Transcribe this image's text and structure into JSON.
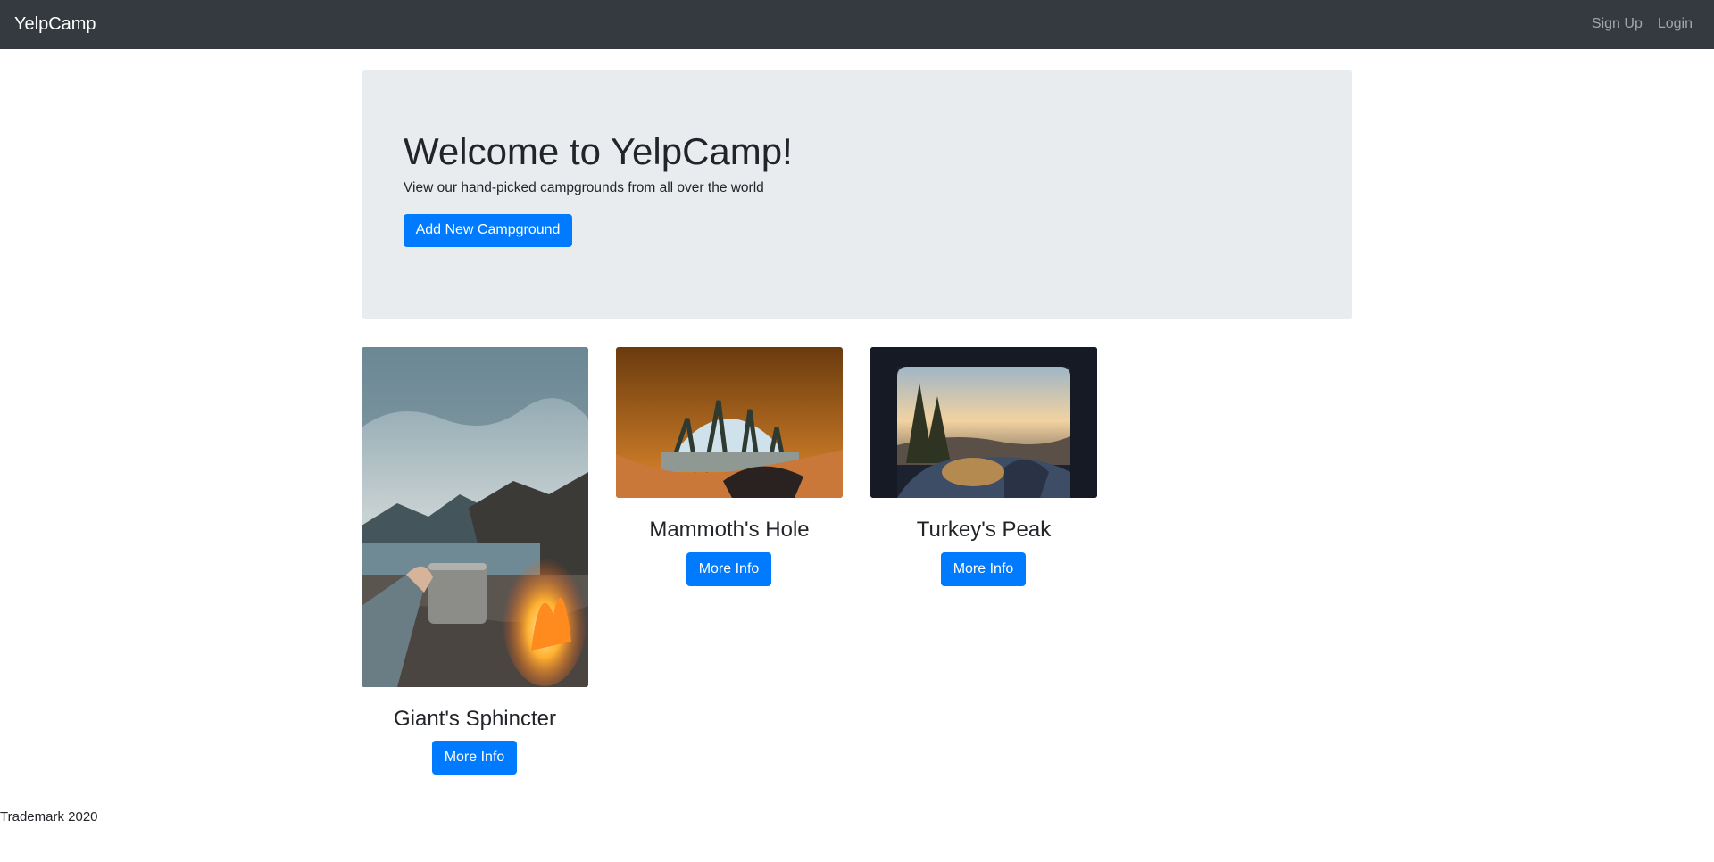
{
  "navbar": {
    "brand": "YelpCamp",
    "links": [
      "Sign Up",
      "Login"
    ]
  },
  "hero": {
    "title": "Welcome to YelpCamp!",
    "lead": "View our hand-picked campgrounds from all over the world",
    "button_label": "Add New Campground"
  },
  "campgrounds": [
    {
      "name": "Giant's Sphincter",
      "button_label": "More Info",
      "image": "campfire-mug-lake-photo"
    },
    {
      "name": "Mammoth's Hole",
      "button_label": "More Info",
      "image": "tent-forest-view-photo"
    },
    {
      "name": "Turkey's Peak",
      "button_label": "More Info",
      "image": "car-trunk-sunset-photo"
    }
  ],
  "footer": {
    "text": "Trademark 2020"
  },
  "colors": {
    "navbar": "#343a40",
    "primary": "#007bff",
    "jumbotron": "#e9ecef",
    "text": "#212529"
  }
}
